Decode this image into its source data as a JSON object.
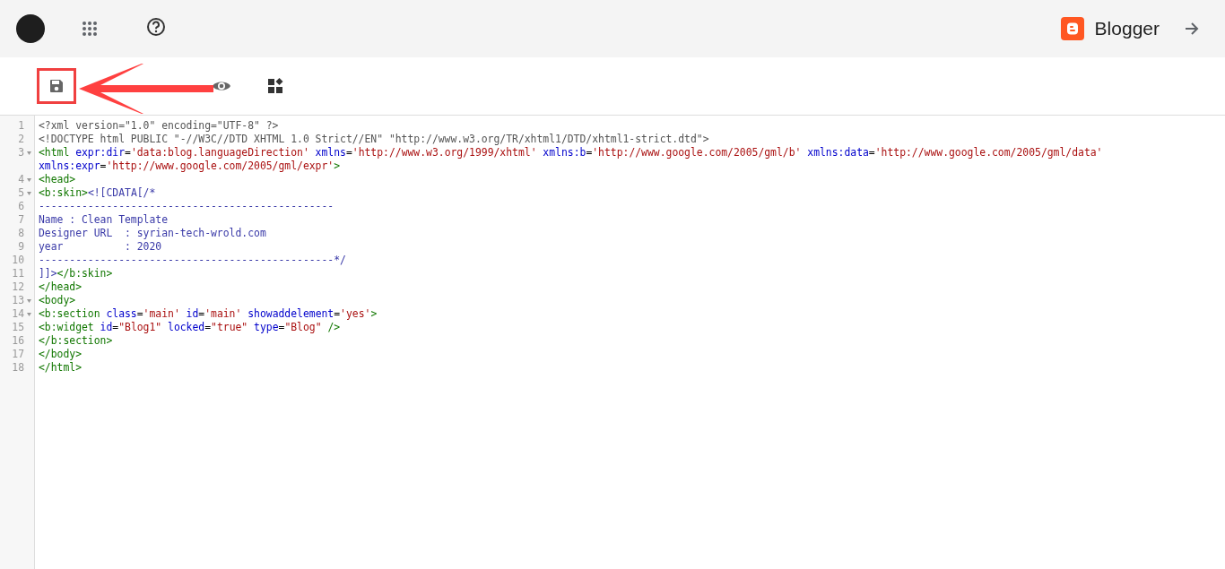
{
  "header": {
    "brand": "Blogger"
  },
  "editor": {
    "lines": [
      {
        "number": "1",
        "foldable": false,
        "visual_rows": [
          {
            "tokens": [
              {
                "kind": "meta",
                "text": "<?xml version=\"1.0\" encoding=\"UTF-8\" ?>"
              }
            ]
          }
        ]
      },
      {
        "number": "2",
        "foldable": false,
        "visual_rows": [
          {
            "tokens": [
              {
                "kind": "meta",
                "text": "<!DOCTYPE html PUBLIC \"-//W3C//DTD XHTML 1.0 Strict//EN\" \"http://www.w3.org/TR/xhtml1/DTD/xhtml1-strict.dtd\">"
              }
            ]
          }
        ]
      },
      {
        "number": "3",
        "foldable": true,
        "visual_rows": [
          {
            "tokens": [
              {
                "kind": "tag",
                "text": "<html"
              },
              {
                "kind": "attr",
                "text": " expr:dir"
              },
              {
                "kind": "plain",
                "text": "="
              },
              {
                "kind": "string",
                "text": "'data:blog.languageDirection'"
              },
              {
                "kind": "attr",
                "text": " xmlns"
              },
              {
                "kind": "plain",
                "text": "="
              },
              {
                "kind": "string",
                "text": "'http://www.w3.org/1999/xhtml'"
              },
              {
                "kind": "attr",
                "text": " xmlns:b"
              },
              {
                "kind": "plain",
                "text": "="
              },
              {
                "kind": "string",
                "text": "'http://www.google.com/2005/gml/b'"
              },
              {
                "kind": "attr",
                "text": " xmlns:data"
              },
              {
                "kind": "plain",
                "text": "="
              },
              {
                "kind": "string",
                "text": "'http://www.google.com/2005/gml/data'"
              }
            ]
          },
          {
            "tokens": [
              {
                "kind": "attr",
                "text": "xmlns:expr"
              },
              {
                "kind": "plain",
                "text": "="
              },
              {
                "kind": "string",
                "text": "'http://www.google.com/2005/gml/expr'"
              },
              {
                "kind": "tag",
                "text": ">"
              }
            ]
          }
        ]
      },
      {
        "number": "4",
        "foldable": true,
        "visual_rows": [
          {
            "tokens": [
              {
                "kind": "tag",
                "text": "<head>"
              }
            ]
          }
        ]
      },
      {
        "number": "5",
        "foldable": true,
        "visual_rows": [
          {
            "tokens": [
              {
                "kind": "tag",
                "text": "<b:skin>"
              },
              {
                "kind": "comment",
                "text": "<![CDATA[/*"
              }
            ]
          }
        ]
      },
      {
        "number": "6",
        "foldable": false,
        "visual_rows": [
          {
            "tokens": [
              {
                "kind": "comment",
                "text": "------------------------------------------------"
              }
            ]
          }
        ]
      },
      {
        "number": "7",
        "foldable": false,
        "visual_rows": [
          {
            "tokens": [
              {
                "kind": "comment",
                "text": "Name : Clean Template"
              }
            ]
          }
        ]
      },
      {
        "number": "8",
        "foldable": false,
        "visual_rows": [
          {
            "tokens": [
              {
                "kind": "comment",
                "text": "Designer URL  : syrian-tech-wrold.com"
              }
            ]
          }
        ]
      },
      {
        "number": "9",
        "foldable": false,
        "visual_rows": [
          {
            "tokens": [
              {
                "kind": "comment",
                "text": "year          : 2020"
              }
            ]
          }
        ]
      },
      {
        "number": "10",
        "foldable": false,
        "visual_rows": [
          {
            "tokens": [
              {
                "kind": "comment",
                "text": "------------------------------------------------*/"
              }
            ]
          }
        ]
      },
      {
        "number": "11",
        "foldable": false,
        "visual_rows": [
          {
            "tokens": [
              {
                "kind": "comment",
                "text": "]]>"
              },
              {
                "kind": "tag",
                "text": "</b:skin>"
              }
            ]
          }
        ]
      },
      {
        "number": "12",
        "foldable": false,
        "visual_rows": [
          {
            "tokens": [
              {
                "kind": "tag",
                "text": "</head>"
              }
            ]
          }
        ]
      },
      {
        "number": "13",
        "foldable": true,
        "visual_rows": [
          {
            "tokens": [
              {
                "kind": "tag",
                "text": "<body>"
              }
            ]
          }
        ]
      },
      {
        "number": "14",
        "foldable": true,
        "visual_rows": [
          {
            "tokens": [
              {
                "kind": "tag",
                "text": "<b:section"
              },
              {
                "kind": "attr",
                "text": " class"
              },
              {
                "kind": "plain",
                "text": "="
              },
              {
                "kind": "string",
                "text": "'main'"
              },
              {
                "kind": "attr",
                "text": " id"
              },
              {
                "kind": "plain",
                "text": "="
              },
              {
                "kind": "string",
                "text": "'main'"
              },
              {
                "kind": "attr",
                "text": " showaddelement"
              },
              {
                "kind": "plain",
                "text": "="
              },
              {
                "kind": "string",
                "text": "'yes'"
              },
              {
                "kind": "tag",
                "text": ">"
              }
            ]
          }
        ]
      },
      {
        "number": "15",
        "foldable": false,
        "visual_rows": [
          {
            "tokens": [
              {
                "kind": "tag",
                "text": "<b:widget"
              },
              {
                "kind": "attr",
                "text": " id"
              },
              {
                "kind": "plain",
                "text": "="
              },
              {
                "kind": "string",
                "text": "\"Blog1\""
              },
              {
                "kind": "attr",
                "text": " locked"
              },
              {
                "kind": "plain",
                "text": "="
              },
              {
                "kind": "string",
                "text": "\"true\""
              },
              {
                "kind": "attr",
                "text": " type"
              },
              {
                "kind": "plain",
                "text": "="
              },
              {
                "kind": "string",
                "text": "\"Blog\""
              },
              {
                "kind": "tag",
                "text": " />"
              }
            ]
          }
        ]
      },
      {
        "number": "16",
        "foldable": false,
        "visual_rows": [
          {
            "tokens": [
              {
                "kind": "tag",
                "text": "</b:section>"
              }
            ]
          }
        ]
      },
      {
        "number": "17",
        "foldable": false,
        "visual_rows": [
          {
            "tokens": [
              {
                "kind": "tag",
                "text": "</body>"
              }
            ]
          }
        ]
      },
      {
        "number": "18",
        "foldable": false,
        "visual_rows": [
          {
            "tokens": [
              {
                "kind": "tag",
                "text": "</html>"
              }
            ]
          }
        ]
      }
    ]
  }
}
